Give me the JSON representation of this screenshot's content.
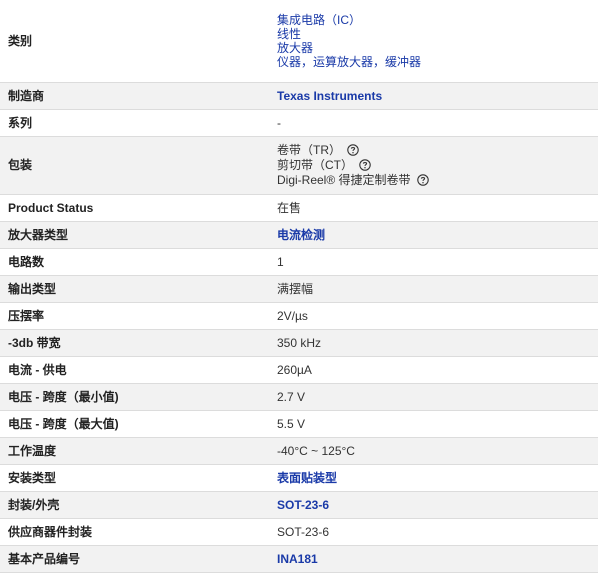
{
  "colors": {
    "link": "#1a3aa8",
    "row_alt": "#f2f2f2",
    "border": "#dcdcdc"
  },
  "rows": [
    {
      "label": "类别",
      "values": [
        "集成电路（IC）",
        "线性",
        "放大器",
        "仪器，运算放大器，缓冲器"
      ]
    },
    {
      "label": "制造商",
      "value": "Texas Instruments"
    },
    {
      "label": "系列",
      "value": "-"
    },
    {
      "label": "包装",
      "values": [
        "卷带（TR）",
        "剪切带（CT）",
        "Digi-Reel® 得捷定制卷带"
      ],
      "icon": "help-circle-icon"
    },
    {
      "label": "Product Status",
      "value": "在售"
    },
    {
      "label": "放大器类型",
      "value": "电流检测"
    },
    {
      "label": "电路数",
      "value": "1"
    },
    {
      "label": "输出类型",
      "value": "满摆幅"
    },
    {
      "label": "压摆率",
      "value": "2V/µs"
    },
    {
      "label": "-3db 带宽",
      "value": "350 kHz"
    },
    {
      "label": "电流 - 供电",
      "value": "260µA"
    },
    {
      "label": "电压 - 跨度（最小值)",
      "value": "2.7 V"
    },
    {
      "label": "电压 - 跨度（最大值)",
      "value": "5.5 V"
    },
    {
      "label": "工作温度",
      "value": "-40°C ~ 125°C"
    },
    {
      "label": "安装类型",
      "value": "表面贴装型"
    },
    {
      "label": "封装/外壳",
      "value": "SOT-23-6"
    },
    {
      "label": "供应商器件封装",
      "value": "SOT-23-6"
    },
    {
      "label": "基本产品编号",
      "value": "INA181"
    }
  ]
}
